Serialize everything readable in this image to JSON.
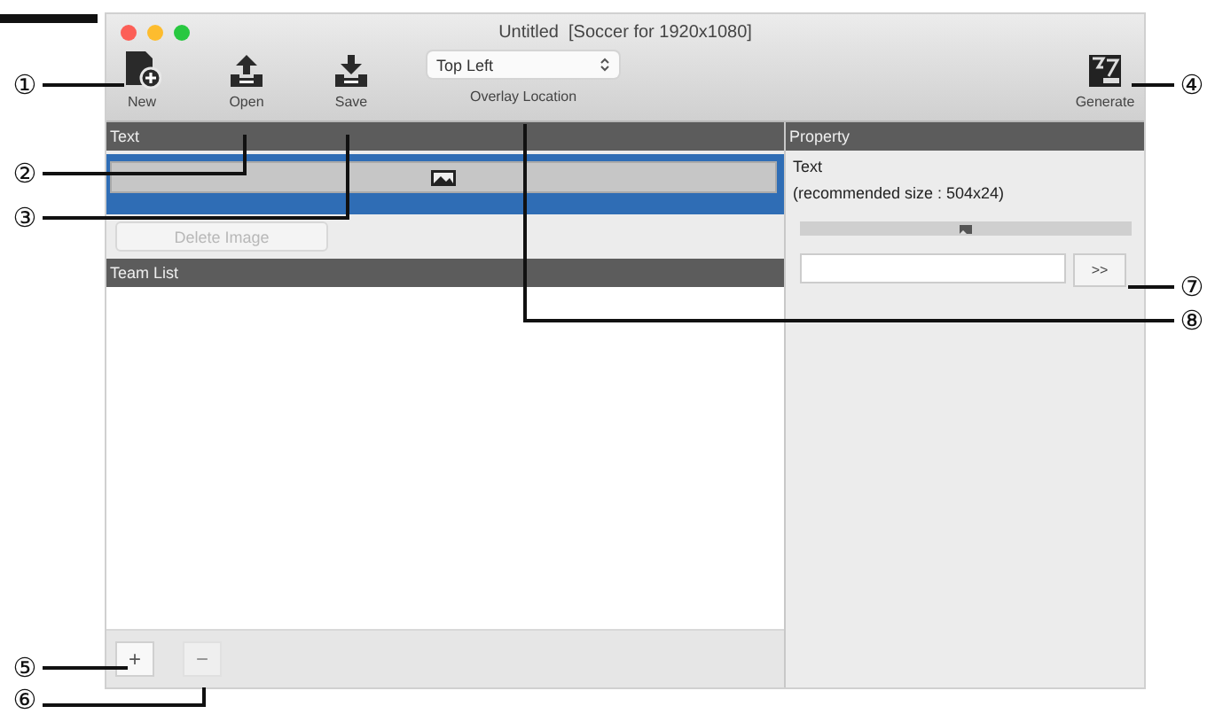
{
  "window": {
    "title": "Untitled  [Soccer for 1920x1080]"
  },
  "toolbar": {
    "buttons": [
      {
        "label": "New",
        "kind": "new"
      },
      {
        "label": "Open",
        "kind": "open"
      },
      {
        "label": "Save",
        "kind": "save"
      }
    ],
    "overlay_location": {
      "value": "Top Left",
      "label": "Overlay Location"
    },
    "generate": {
      "label": "Generate"
    }
  },
  "text_panel": {
    "header": "Text",
    "rows": [
      {
        "selected": true
      }
    ],
    "delete_button": {
      "label": "Delete Image",
      "disabled": true
    }
  },
  "team_list": {
    "header": "Team List",
    "add_button": {
      "label": "+",
      "disabled": false
    },
    "remove_button": {
      "label": "−",
      "disabled": true
    }
  },
  "property": {
    "header": "Property",
    "title": "Text",
    "hint": "(recommended size : 504x24)",
    "apply_button": ">>"
  },
  "callouts": [
    {
      "label": "①"
    },
    {
      "label": "④"
    },
    {
      "label": "②"
    },
    {
      "label": "③"
    },
    {
      "label": "⑦"
    },
    {
      "label": "⑧"
    },
    {
      "label": "⑤"
    },
    {
      "label": "⑥"
    }
  ]
}
